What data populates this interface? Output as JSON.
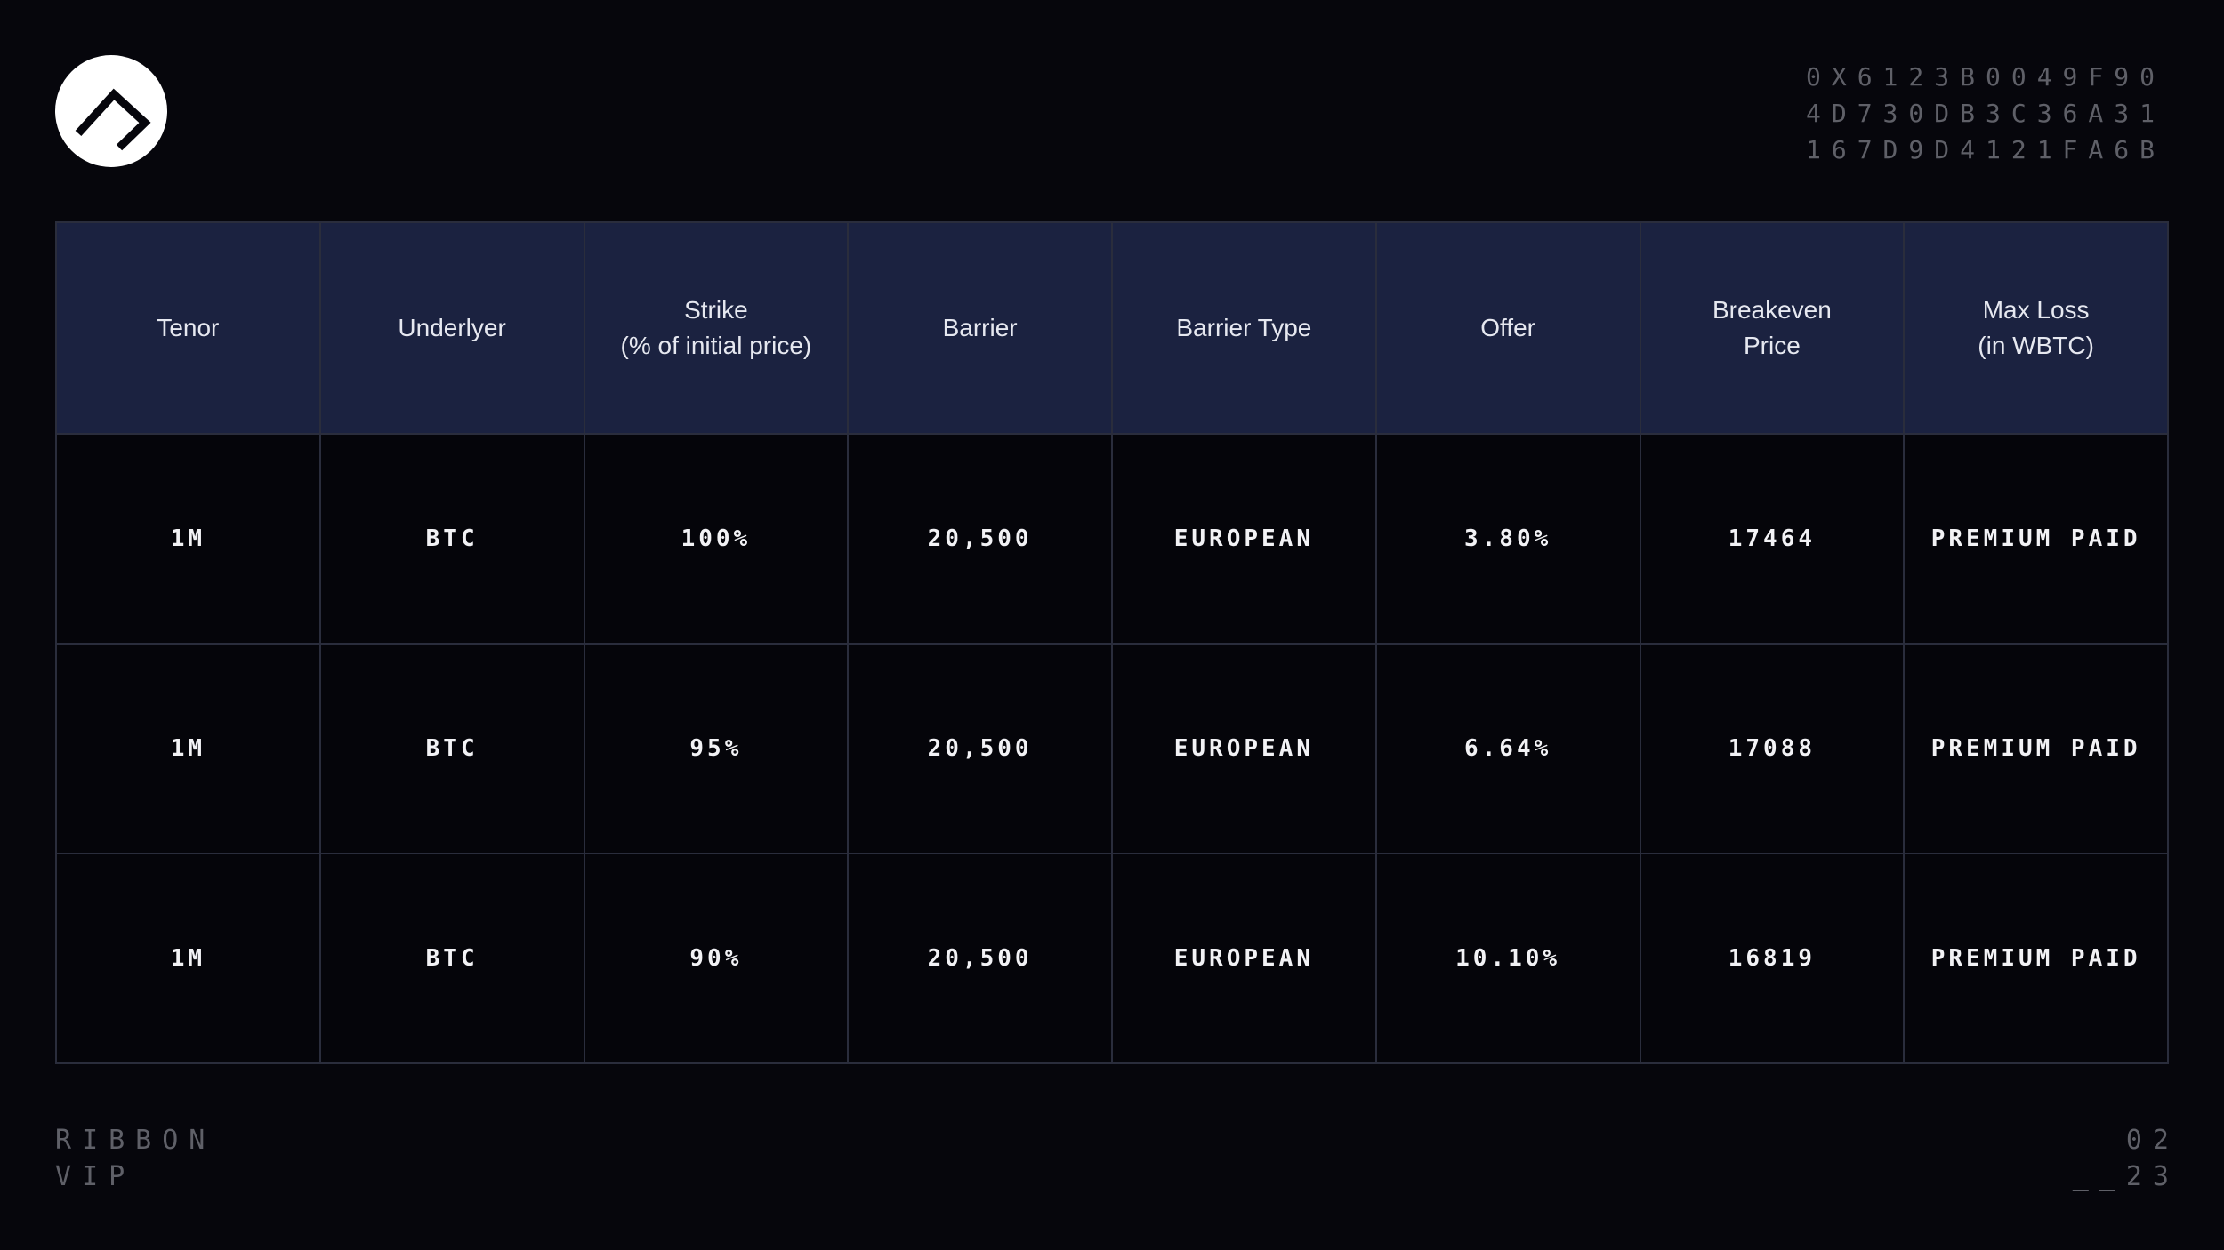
{
  "brand": {
    "logo_icon": "ribbon-logo-icon",
    "name_line1": "RIBBON",
    "name_line2": "VIP"
  },
  "hash": {
    "line1": "0X6123B0049F90",
    "line2": "4D730DB3C36A31",
    "line3": "167D9D4121FA6B"
  },
  "page": {
    "line1": "02",
    "line2": "__23"
  },
  "table": {
    "headers": [
      {
        "line1": "Tenor",
        "line2": ""
      },
      {
        "line1": "Underlyer",
        "line2": ""
      },
      {
        "line1": "Strike",
        "line2": "(% of initial price)"
      },
      {
        "line1": "Barrier",
        "line2": ""
      },
      {
        "line1": "Barrier Type",
        "line2": ""
      },
      {
        "line1": "Offer",
        "line2": ""
      },
      {
        "line1": "Breakeven",
        "line2": "Price"
      },
      {
        "line1": "Max Loss",
        "line2": "(in WBTC)"
      }
    ],
    "rows": [
      [
        "1M",
        "BTC",
        "100%",
        "20,500",
        "EUROPEAN",
        "3.80%",
        "17464",
        "PREMIUM PAID"
      ],
      [
        "1M",
        "BTC",
        "95%",
        "20,500",
        "EUROPEAN",
        "6.64%",
        "17088",
        "PREMIUM PAID"
      ],
      [
        "1M",
        "BTC",
        "90%",
        "20,500",
        "EUROPEAN",
        "10.10%",
        "16819",
        "PREMIUM PAID"
      ]
    ]
  },
  "colors": {
    "background": "#06060c",
    "header_bg": "#1b2240",
    "grid": "#2a2d3c",
    "muted_text": "#5f6068"
  }
}
